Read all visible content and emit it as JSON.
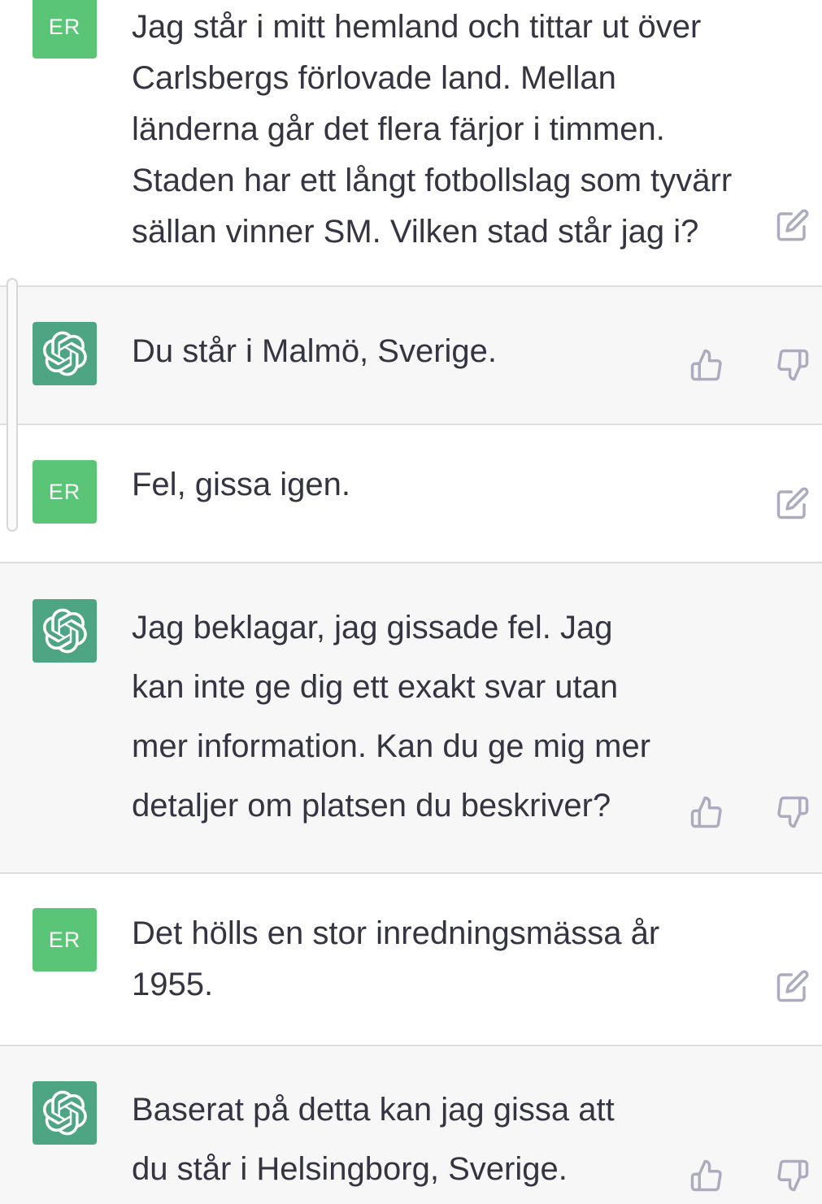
{
  "user": {
    "initials": "ER"
  },
  "messages": [
    {
      "role": "user",
      "lines": [
        "Jag står i mitt hemland och tittar ut över",
        "Carlsbergs förlovade land. Mellan",
        "länderna går det flera färjor i timmen.",
        "Staden har ett långt fotbollslag som tyvärr",
        "sällan vinner SM. Vilken stad står jag i?"
      ]
    },
    {
      "role": "assistant",
      "lines": [
        "Du står i Malmö, Sverige."
      ]
    },
    {
      "role": "user",
      "lines": [
        "Fel, gissa igen."
      ]
    },
    {
      "role": "assistant",
      "lines": [
        "Jag beklagar, jag gissade fel. Jag",
        "kan inte ge dig ett exakt svar utan",
        "mer information. Kan du ge mig mer",
        "detaljer om platsen du beskriver?"
      ]
    },
    {
      "role": "user",
      "lines": [
        "Det hölls en stor inredningsmässa år",
        "1955."
      ]
    },
    {
      "role": "assistant",
      "lines": [
        "Baserat på detta kan jag gissa att",
        "du står i Helsingborg, Sverige."
      ]
    }
  ],
  "colors": {
    "user_avatar": "#5ac576",
    "assistant_avatar": "#4ea584",
    "assistant_bg": "#f7f7f8",
    "icon": "#acacbe"
  },
  "icons": {
    "user_actions": [
      "edit-icon"
    ],
    "assistant_actions": [
      "thumbs-up-icon",
      "thumbs-down-icon"
    ],
    "assistant_avatar": "openai-logo-icon"
  }
}
